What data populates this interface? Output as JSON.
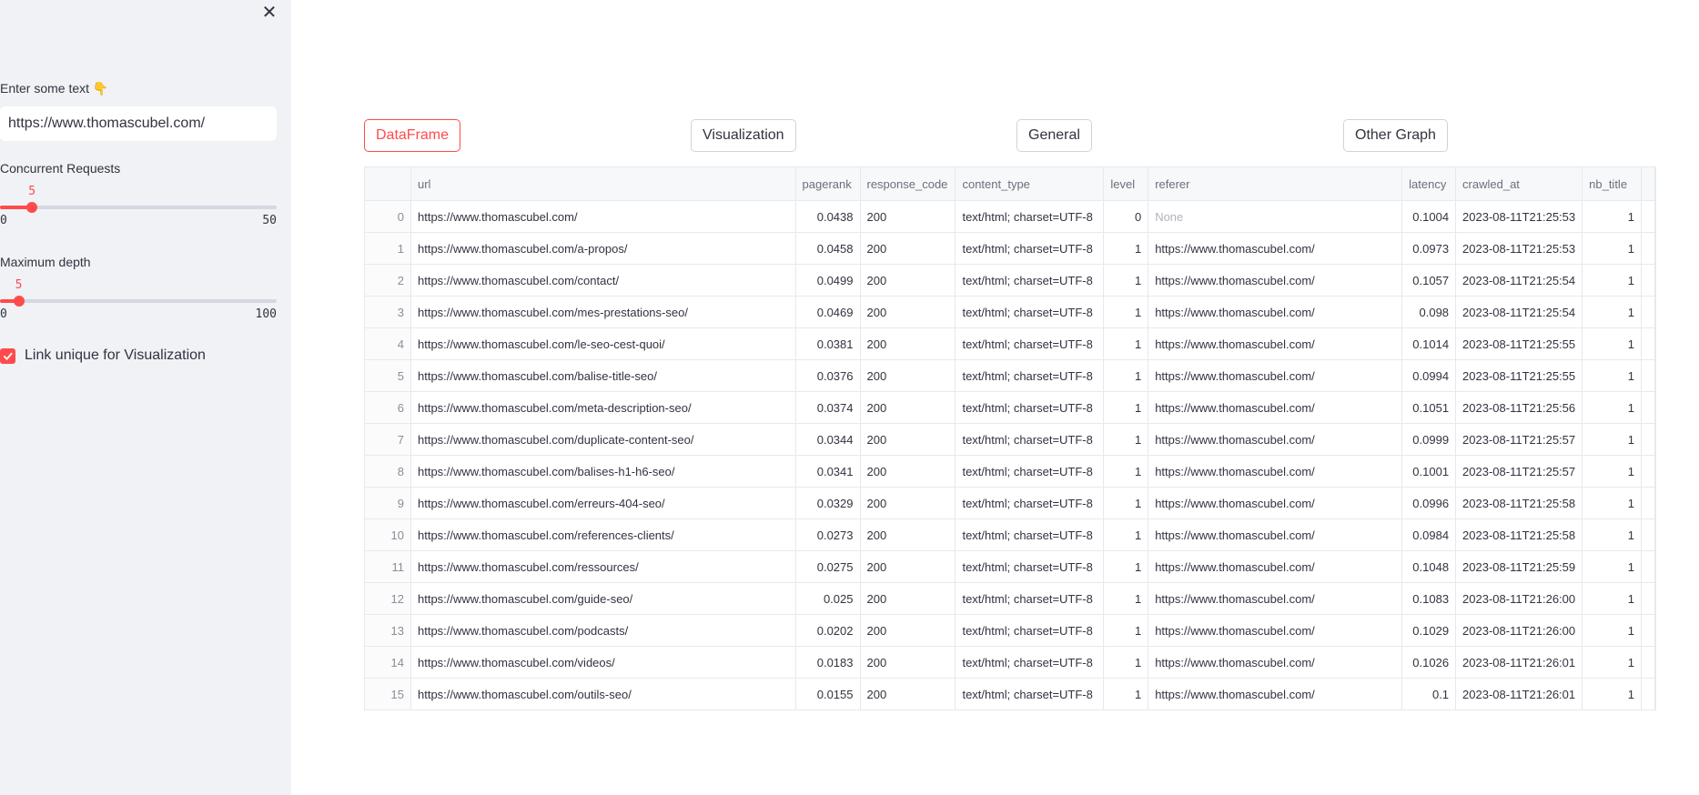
{
  "sidebar": {
    "text_label": "Enter some text 👇",
    "text_value": "https://www.thomascubel.com/",
    "concurrent": {
      "label": "Concurrent Requests",
      "value": "5",
      "min": "0",
      "max": "50",
      "fraction": 0.1
    },
    "depth": {
      "label": "Maximum depth",
      "value": "5",
      "min": "0",
      "max": "100",
      "fraction": 0.05
    },
    "checkbox": {
      "label": "Link unique for Visualization",
      "checked": true
    }
  },
  "tabs": [
    "DataFrame",
    "Visualization",
    "General",
    "Other Graph"
  ],
  "table": {
    "columns": [
      "url",
      "pagerank",
      "response_code",
      "content_type",
      "level",
      "referer",
      "latency",
      "crawled_at",
      "nb_title"
    ],
    "rows": [
      [
        "0",
        "https://www.thomascubel.com/",
        "0.0438",
        "200",
        "text/html; charset=UTF-8",
        "0",
        "None",
        "0.1004",
        "2023-08-11T21:25:53",
        "1"
      ],
      [
        "1",
        "https://www.thomascubel.com/a-propos/",
        "0.0458",
        "200",
        "text/html; charset=UTF-8",
        "1",
        "https://www.thomascubel.com/",
        "0.0973",
        "2023-08-11T21:25:53",
        "1"
      ],
      [
        "2",
        "https://www.thomascubel.com/contact/",
        "0.0499",
        "200",
        "text/html; charset=UTF-8",
        "1",
        "https://www.thomascubel.com/",
        "0.1057",
        "2023-08-11T21:25:54",
        "1"
      ],
      [
        "3",
        "https://www.thomascubel.com/mes-prestations-seo/",
        "0.0469",
        "200",
        "text/html; charset=UTF-8",
        "1",
        "https://www.thomascubel.com/",
        "0.098",
        "2023-08-11T21:25:54",
        "1"
      ],
      [
        "4",
        "https://www.thomascubel.com/le-seo-cest-quoi/",
        "0.0381",
        "200",
        "text/html; charset=UTF-8",
        "1",
        "https://www.thomascubel.com/",
        "0.1014",
        "2023-08-11T21:25:55",
        "1"
      ],
      [
        "5",
        "https://www.thomascubel.com/balise-title-seo/",
        "0.0376",
        "200",
        "text/html; charset=UTF-8",
        "1",
        "https://www.thomascubel.com/",
        "0.0994",
        "2023-08-11T21:25:55",
        "1"
      ],
      [
        "6",
        "https://www.thomascubel.com/meta-description-seo/",
        "0.0374",
        "200",
        "text/html; charset=UTF-8",
        "1",
        "https://www.thomascubel.com/",
        "0.1051",
        "2023-08-11T21:25:56",
        "1"
      ],
      [
        "7",
        "https://www.thomascubel.com/duplicate-content-seo/",
        "0.0344",
        "200",
        "text/html; charset=UTF-8",
        "1",
        "https://www.thomascubel.com/",
        "0.0999",
        "2023-08-11T21:25:57",
        "1"
      ],
      [
        "8",
        "https://www.thomascubel.com/balises-h1-h6-seo/",
        "0.0341",
        "200",
        "text/html; charset=UTF-8",
        "1",
        "https://www.thomascubel.com/",
        "0.1001",
        "2023-08-11T21:25:57",
        "1"
      ],
      [
        "9",
        "https://www.thomascubel.com/erreurs-404-seo/",
        "0.0329",
        "200",
        "text/html; charset=UTF-8",
        "1",
        "https://www.thomascubel.com/",
        "0.0996",
        "2023-08-11T21:25:58",
        "1"
      ],
      [
        "10",
        "https://www.thomascubel.com/references-clients/",
        "0.0273",
        "200",
        "text/html; charset=UTF-8",
        "1",
        "https://www.thomascubel.com/",
        "0.0984",
        "2023-08-11T21:25:58",
        "1"
      ],
      [
        "11",
        "https://www.thomascubel.com/ressources/",
        "0.0275",
        "200",
        "text/html; charset=UTF-8",
        "1",
        "https://www.thomascubel.com/",
        "0.1048",
        "2023-08-11T21:25:59",
        "1"
      ],
      [
        "12",
        "https://www.thomascubel.com/guide-seo/",
        "0.025",
        "200",
        "text/html; charset=UTF-8",
        "1",
        "https://www.thomascubel.com/",
        "0.1083",
        "2023-08-11T21:26:00",
        "1"
      ],
      [
        "13",
        "https://www.thomascubel.com/podcasts/",
        "0.0202",
        "200",
        "text/html; charset=UTF-8",
        "1",
        "https://www.thomascubel.com/",
        "0.1029",
        "2023-08-11T21:26:00",
        "1"
      ],
      [
        "14",
        "https://www.thomascubel.com/videos/",
        "0.0183",
        "200",
        "text/html; charset=UTF-8",
        "1",
        "https://www.thomascubel.com/",
        "0.1026",
        "2023-08-11T21:26:01",
        "1"
      ],
      [
        "15",
        "https://www.thomascubel.com/outils-seo/",
        "0.0155",
        "200",
        "text/html; charset=UTF-8",
        "1",
        "https://www.thomascubel.com/",
        "0.1",
        "2023-08-11T21:26:01",
        "1"
      ]
    ]
  },
  "colors": {
    "accent": "#ff4b4b",
    "sidebar_bg": "#f0f2f6"
  },
  "icons": {
    "close": "close-icon",
    "check": "check-icon"
  }
}
